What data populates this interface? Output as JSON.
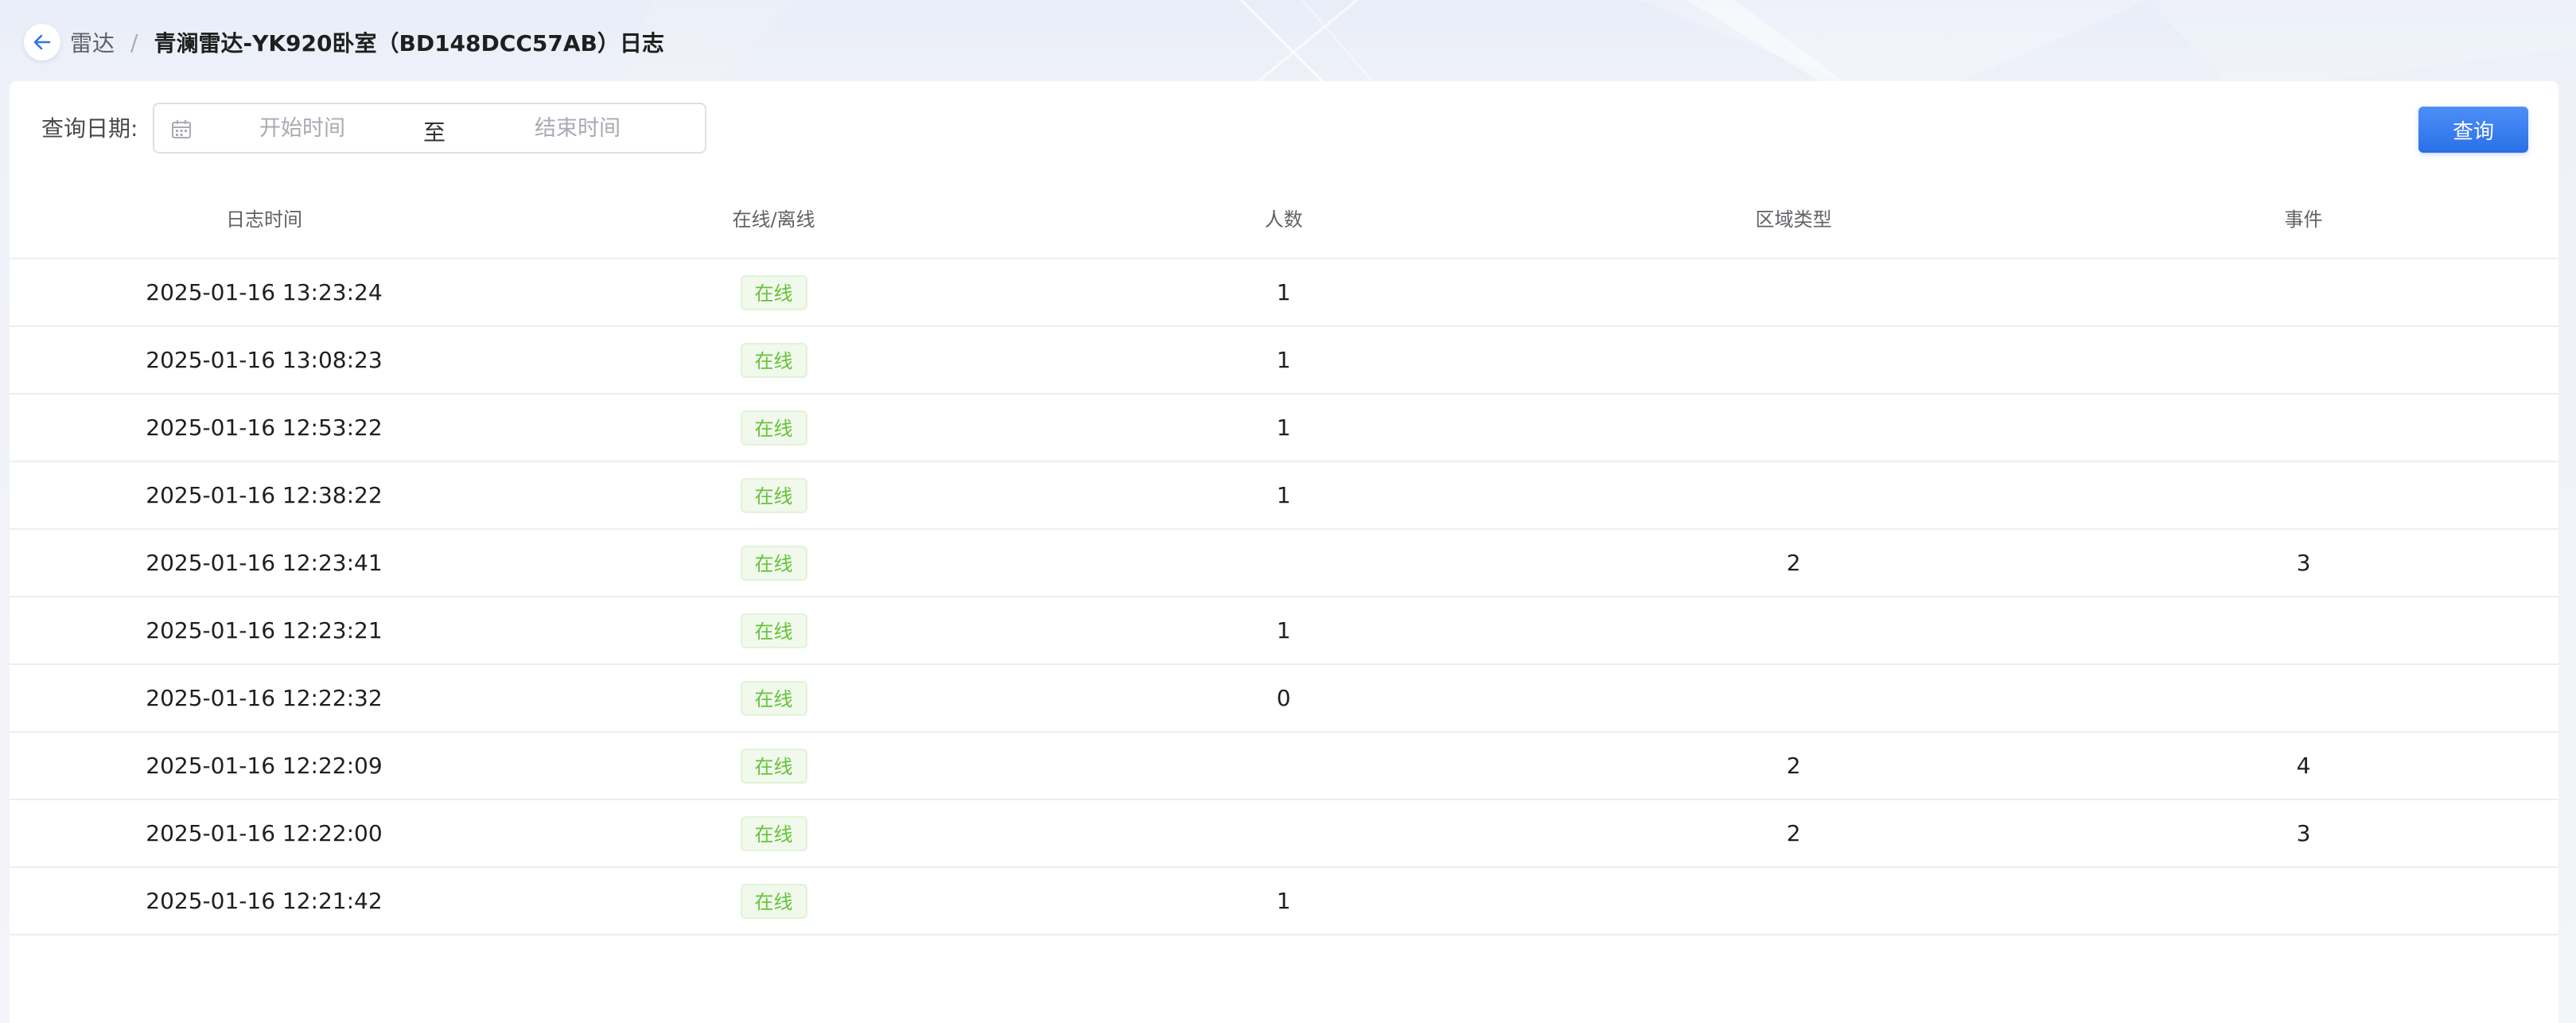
{
  "breadcrumb": {
    "parent": "雷达",
    "separator": "/",
    "current": "青澜雷达-YK920卧室（BD148DCC57AB）日志"
  },
  "filter": {
    "label": "查询日期:",
    "start_placeholder": "开始时间",
    "range_separator": "至",
    "end_placeholder": "结束时间",
    "start_value": "",
    "end_value": ""
  },
  "query_button": "查询",
  "table": {
    "columns": [
      "日志时间",
      "在线/离线",
      "人数",
      "区域类型",
      "事件"
    ],
    "rows": [
      {
        "time": "2025-01-16 13:23:24",
        "status": "在线",
        "count": "1",
        "area": "",
        "event": ""
      },
      {
        "time": "2025-01-16 13:08:23",
        "status": "在线",
        "count": "1",
        "area": "",
        "event": ""
      },
      {
        "time": "2025-01-16 12:53:22",
        "status": "在线",
        "count": "1",
        "area": "",
        "event": ""
      },
      {
        "time": "2025-01-16 12:38:22",
        "status": "在线",
        "count": "1",
        "area": "",
        "event": ""
      },
      {
        "time": "2025-01-16 12:23:41",
        "status": "在线",
        "count": "",
        "area": "2",
        "event": "3"
      },
      {
        "time": "2025-01-16 12:23:21",
        "status": "在线",
        "count": "1",
        "area": "",
        "event": ""
      },
      {
        "time": "2025-01-16 12:22:32",
        "status": "在线",
        "count": "0",
        "area": "",
        "event": ""
      },
      {
        "time": "2025-01-16 12:22:09",
        "status": "在线",
        "count": "",
        "area": "2",
        "event": "4"
      },
      {
        "time": "2025-01-16 12:22:00",
        "status": "在线",
        "count": "",
        "area": "2",
        "event": "3"
      },
      {
        "time": "2025-01-16 12:21:42",
        "status": "在线",
        "count": "1",
        "area": "",
        "event": ""
      }
    ]
  },
  "icons": {
    "back": "arrow-left-icon",
    "calendar": "calendar-icon"
  },
  "colors": {
    "accent": "#2f74ea",
    "online_tag_text": "#67c23a",
    "online_tag_bg": "#f0f9eb"
  }
}
